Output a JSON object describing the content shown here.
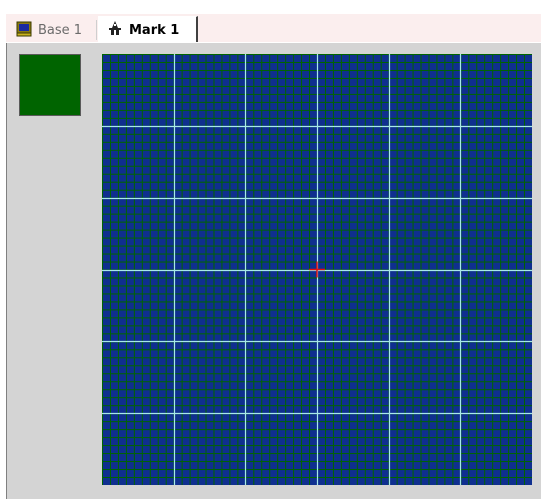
{
  "tabs": [
    {
      "label": "Base 1",
      "icon": "monitor-icon",
      "active": false
    },
    {
      "label": "Mark 1",
      "icon": "wizard-hat-icon",
      "active": true
    }
  ],
  "swatch": {
    "color": "#006400"
  },
  "grid": {
    "background": "#006400",
    "cell_color": "#0f2f8f",
    "major_line_color": "#a8e8e8",
    "minor_line_color": "#006400",
    "major_divisions": 6,
    "minor_per_major": 9,
    "cursor_icon": "crosshair-icon",
    "cursor_color": "#e01010"
  }
}
